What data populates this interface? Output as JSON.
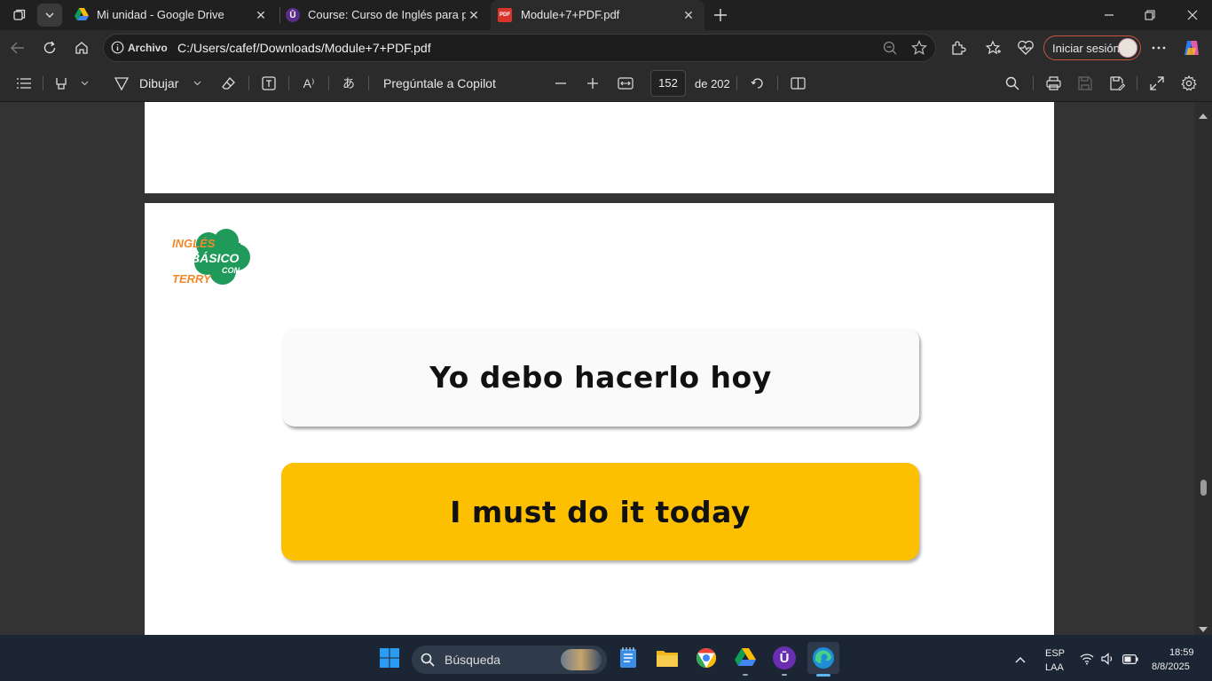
{
  "tabs": [
    {
      "title": "Mi unidad - Google Drive",
      "icon": "google-drive-icon"
    },
    {
      "title": "Course: Curso de Inglés para principiantes",
      "icon": "udemy-icon"
    },
    {
      "title": "Module+7+PDF.pdf",
      "icon": "pdf-icon",
      "active": true
    }
  ],
  "address": {
    "badge": "Archivo",
    "url": "C:/Users/cafef/Downloads/Module+7+PDF.pdf",
    "signin": "Iniciar sesión"
  },
  "pdf_toolbar": {
    "draw_label": "Dibujar",
    "copilot_label": "Pregúntale a Copilot",
    "current_page": "152",
    "total_pages": "de 202"
  },
  "document": {
    "logo": {
      "line1": "INGLÉS",
      "line2": "BÁSICO",
      "line3": "CON",
      "line4": "TERRY"
    },
    "spanish_card": "Yo debo hacerlo hoy",
    "english_card": "I must do it today"
  },
  "taskbar": {
    "search_placeholder": "Búsqueda",
    "lang1": "ESP",
    "lang2": "LAA",
    "time": "18:59",
    "date": "8/8/2025"
  },
  "colors": {
    "accent_yellow": "#fcc000",
    "logo_green": "#1f9a5a",
    "logo_orange": "#f08a2c"
  }
}
